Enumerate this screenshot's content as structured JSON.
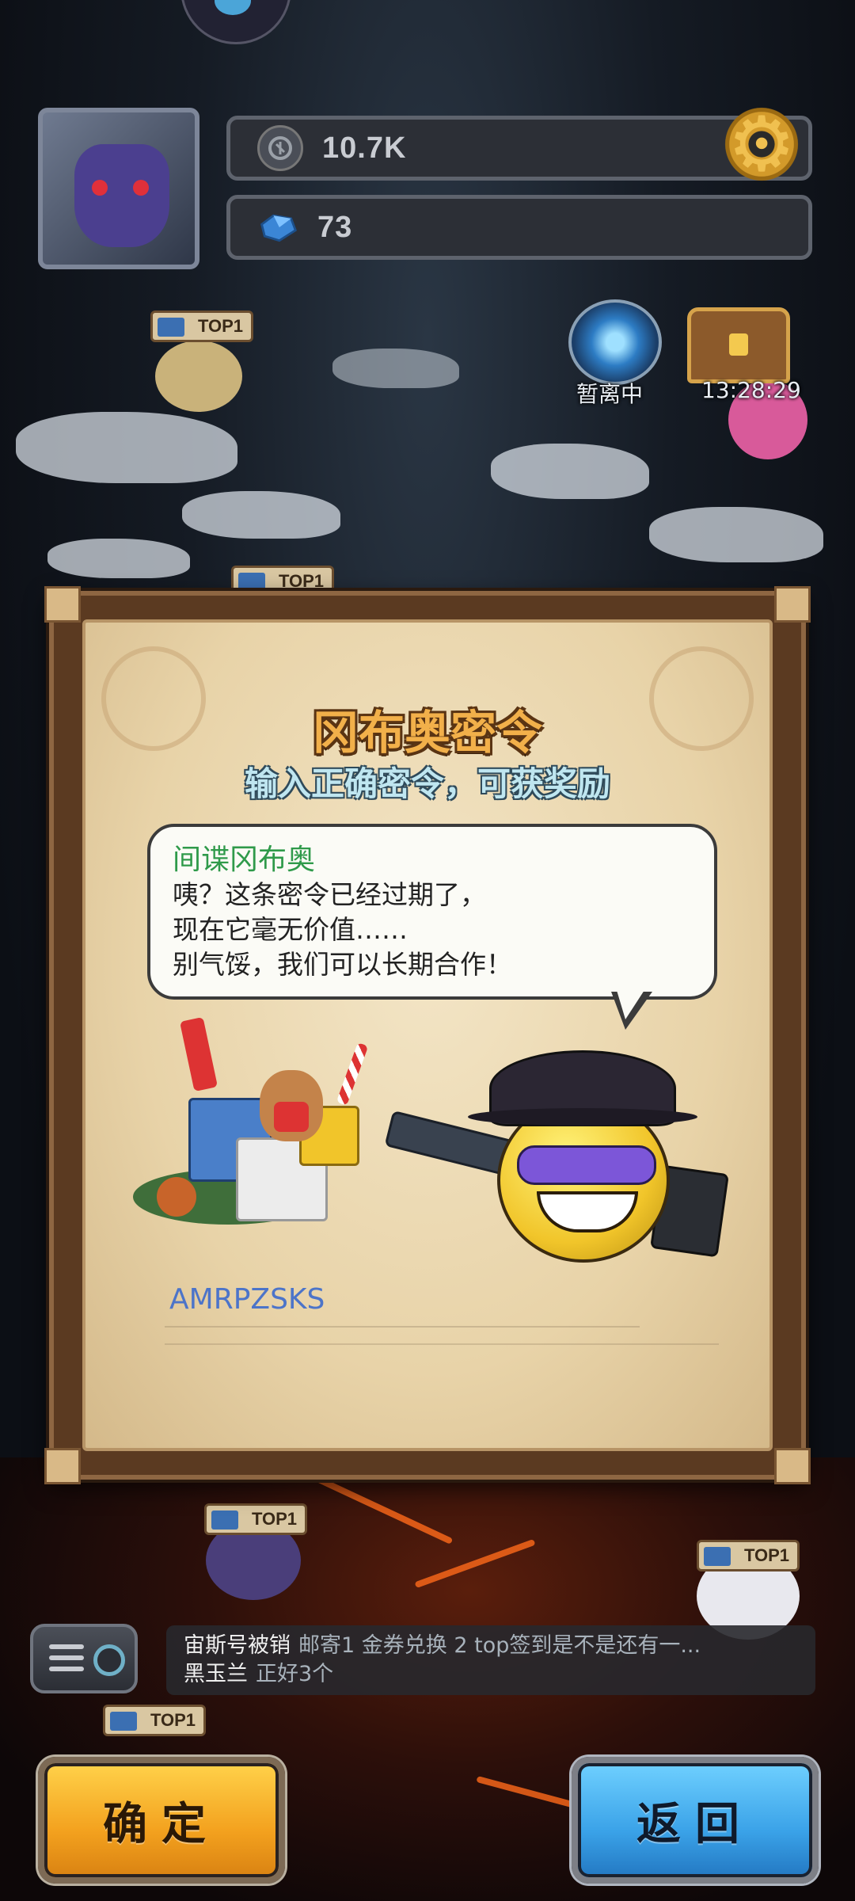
{
  "hud": {
    "currency_value": "10.7K",
    "currency_icon": "coin-icon",
    "gem_value": "73",
    "gem_icon": "gem-icon",
    "settings_icon": "gear-icon"
  },
  "map": {
    "portal_label": "暂离中",
    "chest_timer": "13:28:29",
    "top_flag_text": "TOP1"
  },
  "dialog": {
    "title": "冈布奥密令",
    "subtitle": "输入正确密令，可获奖励",
    "speaker": "间谍冈布奥",
    "lines": [
      "咦？这条密令已经过期了，",
      "现在它毫无价值……",
      "别气馁，我们可以长期合作！"
    ],
    "code_value": "AMRPZSKS"
  },
  "chat": {
    "messages": [
      {
        "user": "宙斯号被销",
        "text": "邮寄1 金券兑换 2 top签到是不是还有一..."
      },
      {
        "user": "黑玉兰",
        "text": "正好3个"
      }
    ]
  },
  "buttons": {
    "confirm": "确定",
    "back": "返回"
  },
  "colors": {
    "title": "#f2b04a",
    "subtitle": "#bfe6f0",
    "speaker": "#2f9a4a",
    "code_text": "#4c74c9",
    "confirm_button": "#f3a11e",
    "back_button": "#3aa2e8"
  }
}
